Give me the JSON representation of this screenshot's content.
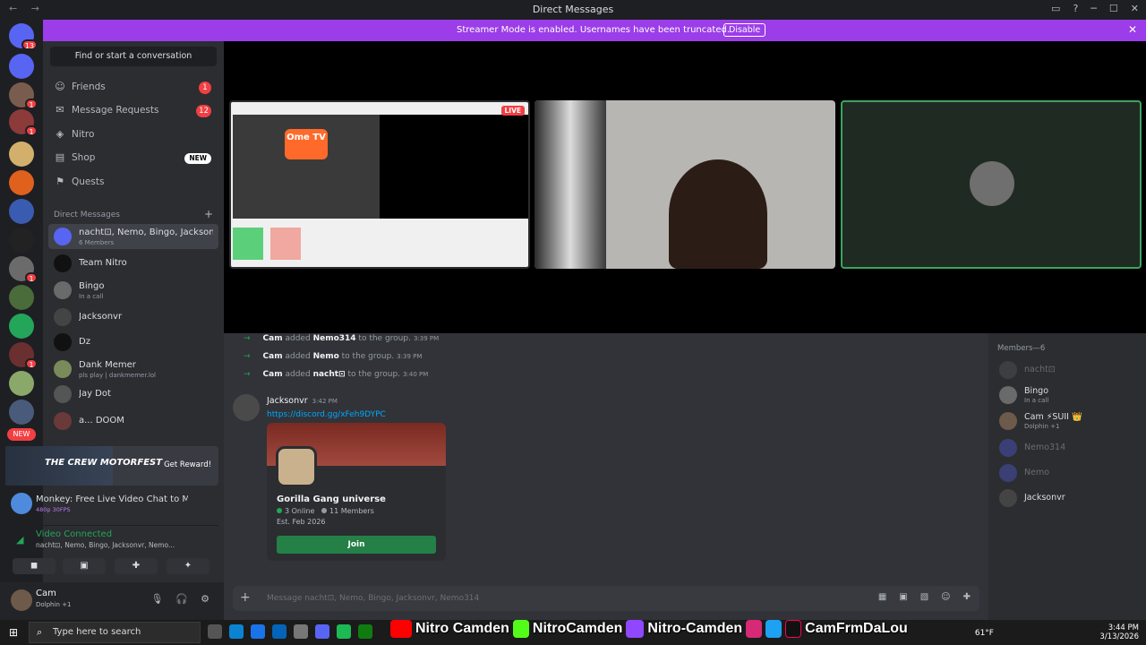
{
  "window": {
    "title": "Direct Messages",
    "nav": "← →"
  },
  "banner": {
    "message": "Streamer Mode is enabled. Usernames have been truncated.",
    "disable_label": "Disable",
    "close": "✕"
  },
  "servers": {
    "badges": [
      "13",
      "1",
      "1",
      "1",
      "1"
    ],
    "new_label": "NEW"
  },
  "dm_sidebar": {
    "find_placeholder": "Find or start a conversation",
    "nav": [
      {
        "label": "Friends",
        "count": "1"
      },
      {
        "label": "Message Requests",
        "count": "12"
      },
      {
        "label": "Nitro"
      },
      {
        "label": "Shop",
        "badge": "NEW"
      },
      {
        "label": "Quests"
      }
    ],
    "dm_header": "Direct Messages",
    "dms": [
      {
        "name": "nacht⊡, Nemo, Bingo, Jacksonv...",
        "sub": "6 Members"
      },
      {
        "name": "Team Nitro"
      },
      {
        "name": "Bingo",
        "sub": "In a call"
      },
      {
        "name": "Jacksonvr"
      },
      {
        "name": "Dz"
      },
      {
        "name": "Dank Memer",
        "sub": "pls play | dankmemer.lol"
      },
      {
        "name": "Jay Dot"
      },
      {
        "name": "a...  DOOM"
      }
    ]
  },
  "promo": {
    "logo": "THE CREW MOTORFEST",
    "cta": "Get Reward!"
  },
  "activity": {
    "title": "Monkey: Free Live Video Chat to M...",
    "sub": "480p 30FPS"
  },
  "voice": {
    "status": "Video Connected",
    "channel": "nacht⊡, Nemo, Bingo, Jacksonvr, Nemo..."
  },
  "user": {
    "name": "Cam",
    "status": "Dolphin +1"
  },
  "stage": {
    "live_label": "LIVE",
    "ome_brand": "Ome TV"
  },
  "chat": {
    "system": [
      {
        "actor": "Cam",
        "verb": "added",
        "target": "Nemo314",
        "rest": "to the group.",
        "time": "3:39 PM"
      },
      {
        "actor": "Cam",
        "verb": "added",
        "target": "Nemo",
        "rest": "to the group.",
        "time": "3:39 PM"
      },
      {
        "actor": "Cam",
        "verb": "added",
        "target": "nacht⊡",
        "rest": "to the group.",
        "time": "3:40 PM"
      }
    ],
    "message": {
      "author": "Jacksonvr",
      "time": "3:42 PM",
      "link": "https://discord.gg/xFeh9DYPC"
    },
    "invite": {
      "guild_name": "Gorilla Gang universe",
      "online": "3 Online",
      "members": "11 Members",
      "established": "Est. Feb 2026",
      "join_label": "Join"
    },
    "composer_placeholder": "Message nacht⊡, Nemo, Bingo, Jacksonvr, Nemo314"
  },
  "members": {
    "header": "Members—6",
    "list": [
      {
        "name": "nacht⊡",
        "offline": true
      },
      {
        "name": "Bingo",
        "sub": "In a call"
      },
      {
        "name": "Cam ⚡SUII 👑",
        "sub": "Dolphin +1"
      },
      {
        "name": "Nemo314",
        "offline": true
      },
      {
        "name": "Nemo",
        "offline": true
      },
      {
        "name": "Jacksonvr"
      }
    ]
  },
  "taskbar": {
    "search_placeholder": "Type here to search",
    "overlay": [
      "Nitro Camden",
      "NitroCamden",
      "Nitro-Camden",
      "CamFrmDaLou"
    ],
    "weather": "61°F",
    "time": "3:44 PM",
    "date": "3/13/2026"
  },
  "colors": {
    "accent": "#5865f2",
    "streamer_banner": "#9b3de8",
    "join_green": "#248046",
    "danger": "#f23f43",
    "link": "#00a8fc"
  }
}
